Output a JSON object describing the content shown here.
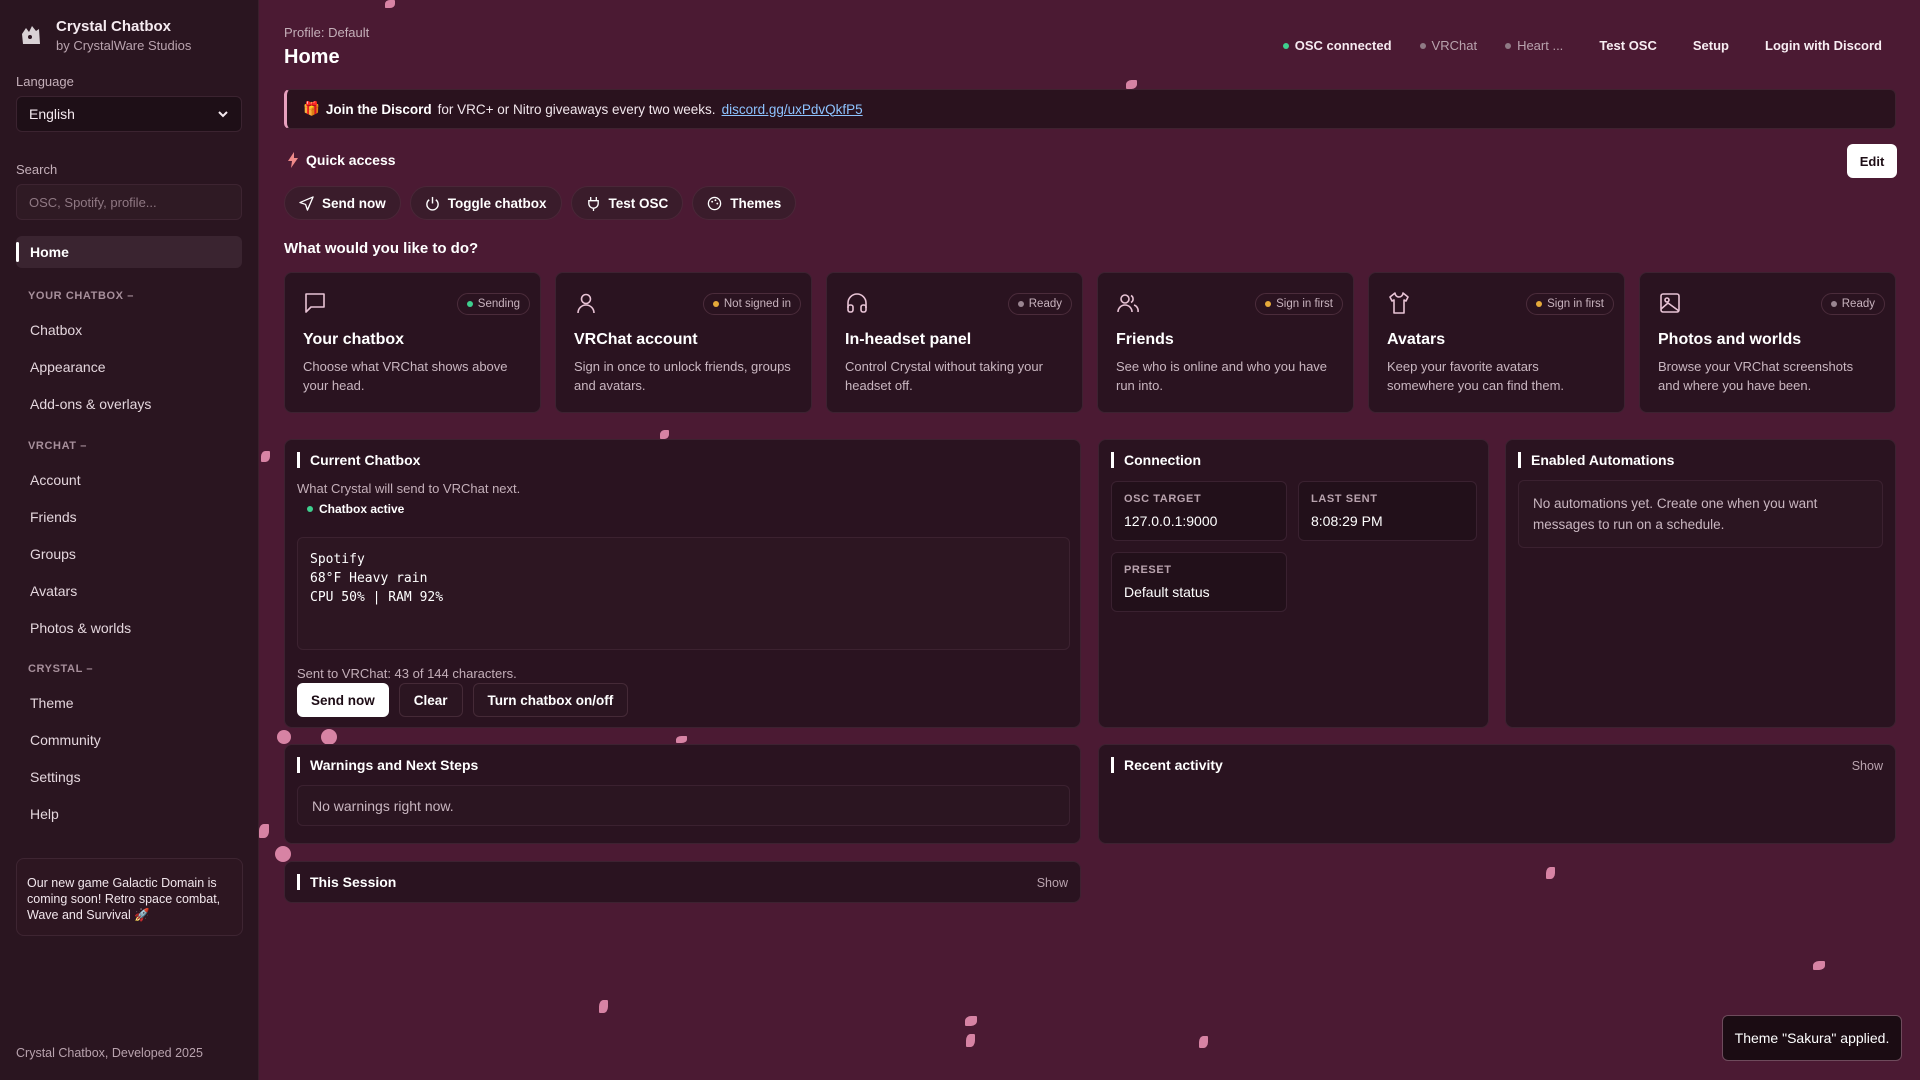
{
  "brand": {
    "title": "Crystal Chatbox",
    "subtitle": "by CrystalWare Studios"
  },
  "sidebar": {
    "language_label": "Language",
    "language_value": "English",
    "search_label": "Search",
    "search_placeholder": "OSC, Spotify, profile...",
    "active_item": "Home",
    "sections": [
      {
        "title": "YOUR CHATBOX",
        "items": [
          "Chatbox",
          "Appearance",
          "Add-ons & overlays"
        ]
      },
      {
        "title": "VRCHAT",
        "items": [
          "Account",
          "Friends",
          "Groups",
          "Avatars",
          "Photos & worlds"
        ]
      },
      {
        "title": "CRYSTAL",
        "items": [
          "Theme",
          "Community",
          "Settings",
          "Help"
        ]
      }
    ],
    "promo": "Our new game Galactic Domain is coming soon! Retro space combat, Wave and Survival 🚀",
    "footer": "Crystal Chatbox, Developed 2025"
  },
  "header": {
    "profile": "Profile: Default",
    "title": "Home",
    "statuses": [
      {
        "label": "OSC connected",
        "color": "#3ecf8e"
      },
      {
        "label": "VRChat",
        "color": "#8f7a85"
      },
      {
        "label": "Heart ...",
        "color": "#8f7a85"
      }
    ],
    "buttons": [
      "Test OSC",
      "Setup",
      "Login with Discord"
    ]
  },
  "banner": {
    "emoji": "🎁",
    "bold": "Join the Discord",
    "text": "for VRC+ or Nitro giveaways every two weeks.",
    "link": "discord.gg/uxPdvQkfP5"
  },
  "quick_access": {
    "title": "Quick access",
    "edit": "Edit",
    "chips": [
      "Send now",
      "Toggle chatbox",
      "Test OSC",
      "Themes"
    ]
  },
  "wwyd": "What would you like to do?",
  "cards": [
    {
      "icon": "chat-bubble-icon",
      "badge": "Sending",
      "badge_color": "#3ecf8e",
      "title": "Your chatbox",
      "desc": "Choose what VRChat shows above your head."
    },
    {
      "icon": "user-icon",
      "badge": "Not signed in",
      "badge_color": "#e5a93a",
      "title": "VRChat account",
      "desc": "Sign in once to unlock friends, groups and avatars."
    },
    {
      "icon": "headset-icon",
      "badge": "Ready",
      "badge_color": "#9a8591",
      "title": "In-headset panel",
      "desc": "Control Crystal without taking your headset off."
    },
    {
      "icon": "users-icon",
      "badge": "Sign in first",
      "badge_color": "#e5a93a",
      "title": "Friends",
      "desc": "See who is online and who you have run into."
    },
    {
      "icon": "shirt-icon",
      "badge": "Sign in first",
      "badge_color": "#e5a93a",
      "title": "Avatars",
      "desc": "Keep your favorite avatars somewhere you can find them."
    },
    {
      "icon": "image-icon",
      "badge": "Ready",
      "badge_color": "#9a8591",
      "title": "Photos and worlds",
      "desc": "Browse your VRChat screenshots and where you have been."
    }
  ],
  "current_chatbox": {
    "title": "Current Chatbox",
    "subtitle": "What Crystal will send to VRChat next.",
    "status": "Chatbox active",
    "lines": [
      "Spotify",
      "68°F Heavy rain",
      "CPU 50% | RAM 92%"
    ],
    "count_text": "Sent to VRChat: 43 of 144 characters.",
    "buttons": [
      "Send now",
      "Clear",
      "Turn chatbox on/off"
    ]
  },
  "connection": {
    "title": "Connection",
    "osc_target_label": "OSC TARGET",
    "osc_target": "127.0.0.1:9000",
    "last_sent_label": "LAST SENT",
    "last_sent": "8:08:29 PM",
    "preset_label": "PRESET",
    "preset": "Default status"
  },
  "automations": {
    "title": "Enabled Automations",
    "empty": "No automations yet. Create one when you want messages to run on a schedule."
  },
  "warnings": {
    "title": "Warnings and Next Steps",
    "empty": "No warnings right now."
  },
  "recent": {
    "title": "Recent activity",
    "show": "Show"
  },
  "session": {
    "title": "This Session",
    "show": "Show"
  },
  "toast": "Theme \"Sakura\" applied."
}
